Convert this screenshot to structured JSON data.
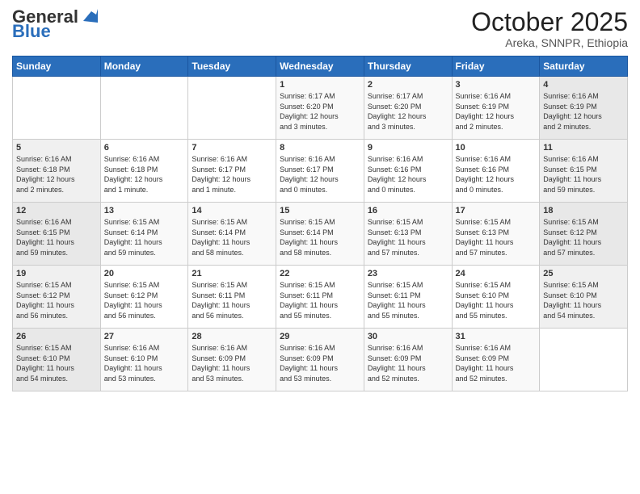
{
  "logo": {
    "general": "General",
    "blue": "Blue"
  },
  "header": {
    "month": "October 2025",
    "location": "Areka, SNNPR, Ethiopia"
  },
  "weekdays": [
    "Sunday",
    "Monday",
    "Tuesday",
    "Wednesday",
    "Thursday",
    "Friday",
    "Saturday"
  ],
  "weeks": [
    [
      {
        "day": "",
        "info": ""
      },
      {
        "day": "",
        "info": ""
      },
      {
        "day": "",
        "info": ""
      },
      {
        "day": "1",
        "info": "Sunrise: 6:17 AM\nSunset: 6:20 PM\nDaylight: 12 hours\nand 3 minutes."
      },
      {
        "day": "2",
        "info": "Sunrise: 6:17 AM\nSunset: 6:20 PM\nDaylight: 12 hours\nand 3 minutes."
      },
      {
        "day": "3",
        "info": "Sunrise: 6:16 AM\nSunset: 6:19 PM\nDaylight: 12 hours\nand 2 minutes."
      },
      {
        "day": "4",
        "info": "Sunrise: 6:16 AM\nSunset: 6:19 PM\nDaylight: 12 hours\nand 2 minutes."
      }
    ],
    [
      {
        "day": "5",
        "info": "Sunrise: 6:16 AM\nSunset: 6:18 PM\nDaylight: 12 hours\nand 2 minutes."
      },
      {
        "day": "6",
        "info": "Sunrise: 6:16 AM\nSunset: 6:18 PM\nDaylight: 12 hours\nand 1 minute."
      },
      {
        "day": "7",
        "info": "Sunrise: 6:16 AM\nSunset: 6:17 PM\nDaylight: 12 hours\nand 1 minute."
      },
      {
        "day": "8",
        "info": "Sunrise: 6:16 AM\nSunset: 6:17 PM\nDaylight: 12 hours\nand 0 minutes."
      },
      {
        "day": "9",
        "info": "Sunrise: 6:16 AM\nSunset: 6:16 PM\nDaylight: 12 hours\nand 0 minutes."
      },
      {
        "day": "10",
        "info": "Sunrise: 6:16 AM\nSunset: 6:16 PM\nDaylight: 12 hours\nand 0 minutes."
      },
      {
        "day": "11",
        "info": "Sunrise: 6:16 AM\nSunset: 6:15 PM\nDaylight: 11 hours\nand 59 minutes."
      }
    ],
    [
      {
        "day": "12",
        "info": "Sunrise: 6:16 AM\nSunset: 6:15 PM\nDaylight: 11 hours\nand 59 minutes."
      },
      {
        "day": "13",
        "info": "Sunrise: 6:15 AM\nSunset: 6:14 PM\nDaylight: 11 hours\nand 59 minutes."
      },
      {
        "day": "14",
        "info": "Sunrise: 6:15 AM\nSunset: 6:14 PM\nDaylight: 11 hours\nand 58 minutes."
      },
      {
        "day": "15",
        "info": "Sunrise: 6:15 AM\nSunset: 6:14 PM\nDaylight: 11 hours\nand 58 minutes."
      },
      {
        "day": "16",
        "info": "Sunrise: 6:15 AM\nSunset: 6:13 PM\nDaylight: 11 hours\nand 57 minutes."
      },
      {
        "day": "17",
        "info": "Sunrise: 6:15 AM\nSunset: 6:13 PM\nDaylight: 11 hours\nand 57 minutes."
      },
      {
        "day": "18",
        "info": "Sunrise: 6:15 AM\nSunset: 6:12 PM\nDaylight: 11 hours\nand 57 minutes."
      }
    ],
    [
      {
        "day": "19",
        "info": "Sunrise: 6:15 AM\nSunset: 6:12 PM\nDaylight: 11 hours\nand 56 minutes."
      },
      {
        "day": "20",
        "info": "Sunrise: 6:15 AM\nSunset: 6:12 PM\nDaylight: 11 hours\nand 56 minutes."
      },
      {
        "day": "21",
        "info": "Sunrise: 6:15 AM\nSunset: 6:11 PM\nDaylight: 11 hours\nand 56 minutes."
      },
      {
        "day": "22",
        "info": "Sunrise: 6:15 AM\nSunset: 6:11 PM\nDaylight: 11 hours\nand 55 minutes."
      },
      {
        "day": "23",
        "info": "Sunrise: 6:15 AM\nSunset: 6:11 PM\nDaylight: 11 hours\nand 55 minutes."
      },
      {
        "day": "24",
        "info": "Sunrise: 6:15 AM\nSunset: 6:10 PM\nDaylight: 11 hours\nand 55 minutes."
      },
      {
        "day": "25",
        "info": "Sunrise: 6:15 AM\nSunset: 6:10 PM\nDaylight: 11 hours\nand 54 minutes."
      }
    ],
    [
      {
        "day": "26",
        "info": "Sunrise: 6:15 AM\nSunset: 6:10 PM\nDaylight: 11 hours\nand 54 minutes."
      },
      {
        "day": "27",
        "info": "Sunrise: 6:16 AM\nSunset: 6:10 PM\nDaylight: 11 hours\nand 53 minutes."
      },
      {
        "day": "28",
        "info": "Sunrise: 6:16 AM\nSunset: 6:09 PM\nDaylight: 11 hours\nand 53 minutes."
      },
      {
        "day": "29",
        "info": "Sunrise: 6:16 AM\nSunset: 6:09 PM\nDaylight: 11 hours\nand 53 minutes."
      },
      {
        "day": "30",
        "info": "Sunrise: 6:16 AM\nSunset: 6:09 PM\nDaylight: 11 hours\nand 52 minutes."
      },
      {
        "day": "31",
        "info": "Sunrise: 6:16 AM\nSunset: 6:09 PM\nDaylight: 11 hours\nand 52 minutes."
      },
      {
        "day": "",
        "info": ""
      }
    ]
  ]
}
